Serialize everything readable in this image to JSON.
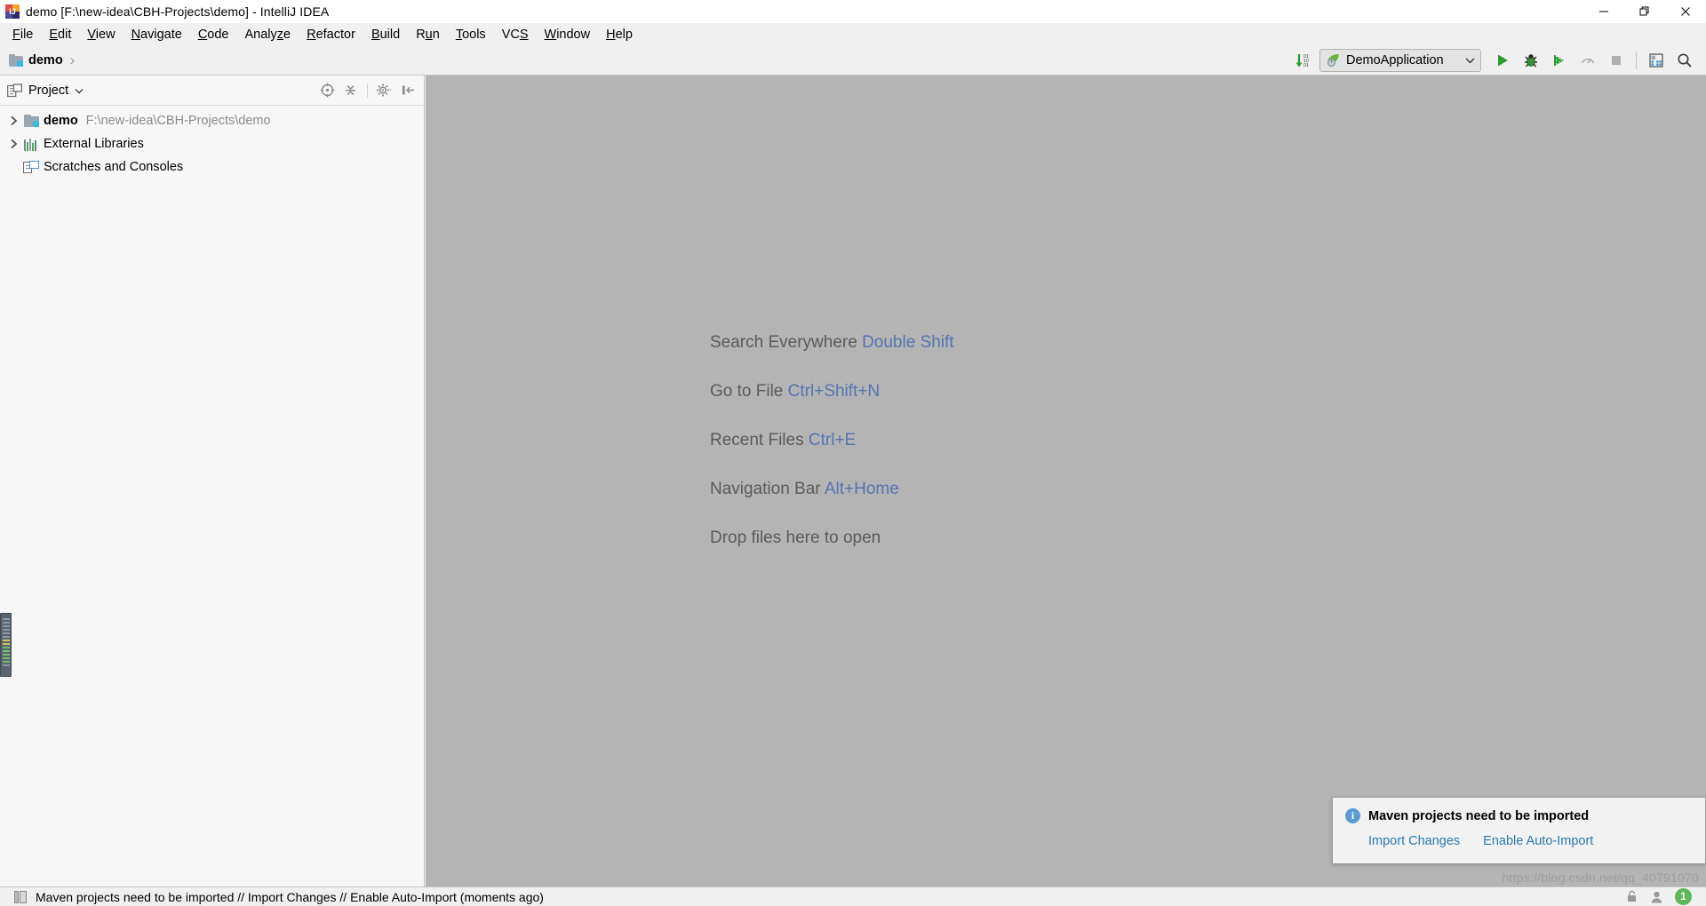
{
  "window": {
    "title": "demo [F:\\new-idea\\CBH-Projects\\demo] - IntelliJ IDEA",
    "app_icon": "intellij-idea-logo",
    "controls": {
      "minimize": "minimize-window",
      "restore": "restore-window",
      "close": "close-window"
    }
  },
  "menubar": {
    "items": [
      {
        "label": "File",
        "mnemonic": "F"
      },
      {
        "label": "Edit",
        "mnemonic": "E"
      },
      {
        "label": "View",
        "mnemonic": "V"
      },
      {
        "label": "Navigate",
        "mnemonic": "N"
      },
      {
        "label": "Code",
        "mnemonic": "C"
      },
      {
        "label": "Analyze",
        "mnemonic": "z"
      },
      {
        "label": "Refactor",
        "mnemonic": "R"
      },
      {
        "label": "Build",
        "mnemonic": "B"
      },
      {
        "label": "Run",
        "mnemonic": "u"
      },
      {
        "label": "Tools",
        "mnemonic": "T"
      },
      {
        "label": "VCS",
        "mnemonic": "S"
      },
      {
        "label": "Window",
        "mnemonic": "W"
      },
      {
        "label": "Help",
        "mnemonic": "H"
      }
    ]
  },
  "navbar": {
    "breadcrumb": [
      {
        "label": "demo",
        "icon": "project-folder-icon"
      }
    ],
    "separator": "›",
    "toolbar": {
      "compile_icon": "download-binary-icon",
      "run_config": {
        "name": "DemoApplication",
        "icon": "spring-boot-icon",
        "chevron": "chevron-down-icon"
      },
      "buttons": [
        {
          "name": "run-button",
          "icon": "play-icon"
        },
        {
          "name": "debug-button",
          "icon": "bug-icon"
        },
        {
          "name": "coverage-button",
          "icon": "run-with-coverage-icon"
        },
        {
          "name": "profile-button",
          "icon": "profiler-icon",
          "disabled": true
        },
        {
          "name": "stop-button",
          "icon": "stop-icon",
          "disabled": true
        },
        {
          "name": "database-button",
          "icon": "database-icon"
        },
        {
          "name": "search-button",
          "icon": "search-icon"
        }
      ]
    }
  },
  "sidebar": {
    "header": {
      "icon": "project-view-icon",
      "title": "Project",
      "chevron": "chevron-down-icon",
      "actions": [
        {
          "name": "select-opened-file-button",
          "icon": "crosshair-icon"
        },
        {
          "name": "collapse-all-button",
          "icon": "collapse-all-icon"
        },
        {
          "name": "settings-button",
          "icon": "gear-icon"
        },
        {
          "name": "hide-panel-button",
          "icon": "hide-left-icon"
        }
      ]
    },
    "tree": [
      {
        "label": "demo",
        "path": "F:\\new-idea\\CBH-Projects\\demo",
        "icon": "project-folder-icon",
        "expandable": true,
        "expanded": false,
        "bold": true
      },
      {
        "label": "External Libraries",
        "path": "",
        "icon": "external-libraries-icon",
        "expandable": true,
        "expanded": false,
        "bold": false
      },
      {
        "label": "Scratches and Consoles",
        "path": "",
        "icon": "scratches-icon",
        "expandable": false,
        "expanded": false,
        "bold": false
      }
    ]
  },
  "editor": {
    "background_color": "#b4b4b4",
    "welcome_hints": [
      {
        "action": "Search Everywhere",
        "shortcut": "Double Shift"
      },
      {
        "action": "Go to File",
        "shortcut": "Ctrl+Shift+N"
      },
      {
        "action": "Recent Files",
        "shortcut": "Ctrl+E"
      },
      {
        "action": "Navigation Bar",
        "shortcut": "Alt+Home"
      },
      {
        "action": "Drop files here to open",
        "shortcut": ""
      }
    ],
    "shortcut_color": "#5774b0",
    "text_color": "#5b5b5b"
  },
  "notification": {
    "icon": "info-icon",
    "title": "Maven projects need to be imported",
    "actions": [
      {
        "label": "Import Changes"
      },
      {
        "label": "Enable Auto-Import"
      }
    ],
    "link_color": "#2a7ab0"
  },
  "statusbar": {
    "icon": "event-log-icon",
    "message": "Maven projects need to be imported // Import Changes // Enable Auto-Import (moments ago)",
    "right_items": [
      {
        "name": "lock-icon"
      },
      {
        "name": "person-icon"
      },
      {
        "name": "notification-count-badge",
        "label": "1",
        "color": "#5aba5a"
      }
    ]
  },
  "watermark": {
    "text": "https://blog.csdn.net/qq_40791070"
  }
}
